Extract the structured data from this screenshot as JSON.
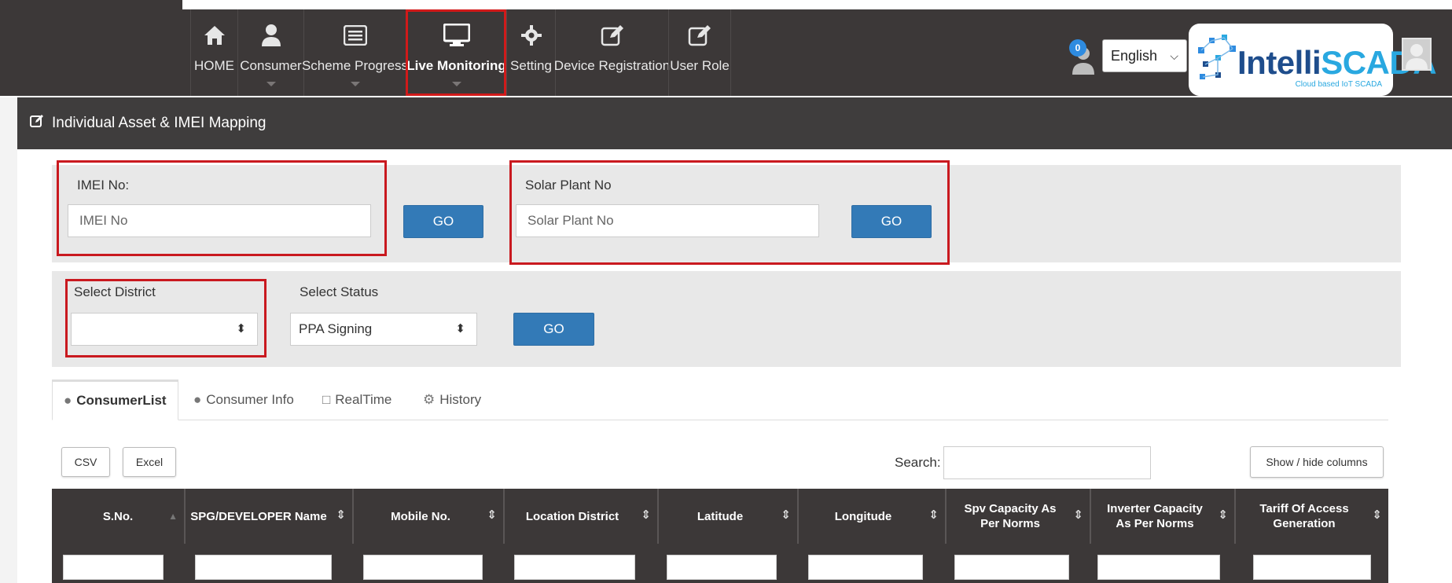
{
  "nav": {
    "items": [
      {
        "label": "HOME",
        "icon": "home-icon"
      },
      {
        "label": "Consumer",
        "icon": "user-icon"
      },
      {
        "label": "Scheme Progress",
        "icon": "list-icon"
      },
      {
        "label": "Live Monitoring",
        "icon": "monitor-icon"
      },
      {
        "label": "Setting",
        "icon": "gear-icon"
      },
      {
        "label": "Device Registration",
        "icon": "edit-icon"
      },
      {
        "label": "User Role",
        "icon": "edit-icon"
      }
    ],
    "notification_count": "0",
    "language": "English",
    "logo": {
      "intel": "Intelli",
      "scada": "SCADA",
      "tagline": "Cloud based IoT SCADA"
    }
  },
  "section": {
    "title": "Individual Asset & IMEI Mapping"
  },
  "imei": {
    "label": "IMEI No:",
    "placeholder": "IMEI No",
    "go": "GO"
  },
  "solar": {
    "label": "Solar Plant No",
    "placeholder": "Solar Plant No",
    "go": "GO"
  },
  "district": {
    "label": "Select District",
    "value": ""
  },
  "status": {
    "label": "Select Status",
    "value": "PPA Signing"
  },
  "filter_go": "GO",
  "tabs": [
    {
      "label": "ConsumerList",
      "icon": "user-icon"
    },
    {
      "label": "Consumer Info",
      "icon": "user-icon"
    },
    {
      "label": "RealTime",
      "icon": "monitor-icon"
    },
    {
      "label": "History",
      "icon": "gear-icon"
    }
  ],
  "toolbar": {
    "csv": "CSV",
    "excel": "Excel",
    "search_label": "Search:",
    "show_hide": "Show / hide columns"
  },
  "table": {
    "columns": [
      "S.No.",
      "SPG/DEVELOPER Name",
      "Mobile No.",
      "Location District",
      "Latitude",
      "Longitude",
      "Spv Capacity As Per Norms",
      "Inverter Capacity As Per Norms",
      "Tariff Of Access Generation"
    ]
  },
  "colors": {
    "navbar": "#3c3838",
    "accent_red": "#c9191f",
    "button_blue": "#337ab7"
  }
}
